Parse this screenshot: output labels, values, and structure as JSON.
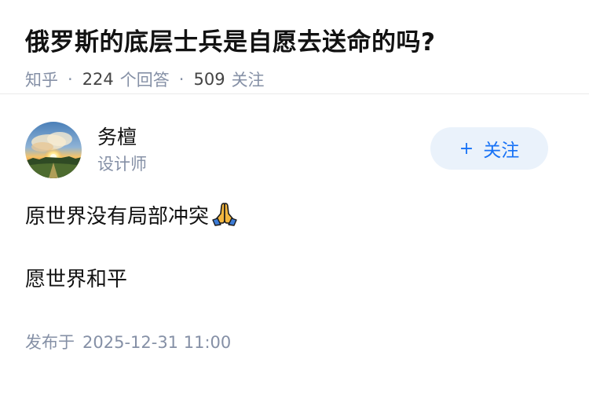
{
  "question": {
    "title": "俄罗斯的底层士兵是自愿去送命的吗?",
    "source": "知乎",
    "answer_count": "224",
    "answer_label": "个回答",
    "follow_count": "509",
    "follow_label": "关注"
  },
  "author": {
    "name": "务檀",
    "bio": "设计师",
    "follow_button": "关注",
    "follow_icon": "plus-icon"
  },
  "content": {
    "paragraph_1": "原世界没有局部冲突",
    "paragraph_1_emoji": "folded-hands-emoji",
    "paragraph_2": "愿世界和平"
  },
  "publish": {
    "label": "发布于",
    "time": "2025-12-31 11:00"
  },
  "colors": {
    "accent": "#1772f6",
    "button_bg": "#eaf2fb",
    "meta_gray": "#8590a6"
  }
}
